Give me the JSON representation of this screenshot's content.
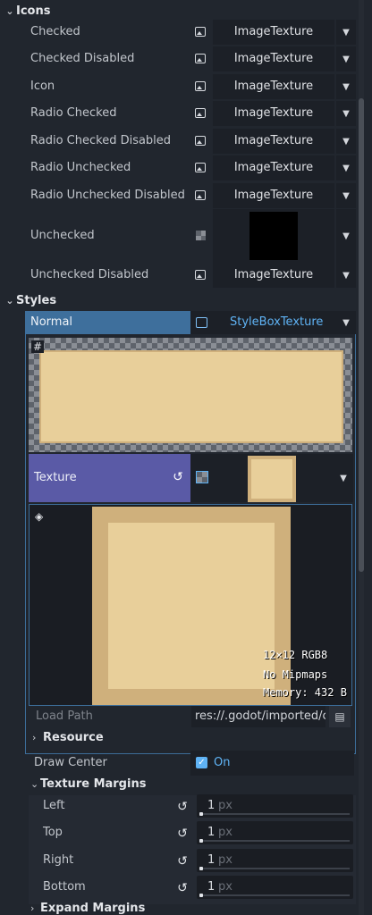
{
  "icons_section": {
    "title": "Icons",
    "rows": [
      {
        "label": "Checked",
        "value": "ImageTexture"
      },
      {
        "label": "Checked Disabled",
        "value": "ImageTexture"
      },
      {
        "label": "Icon",
        "value": "ImageTexture"
      },
      {
        "label": "Radio Checked",
        "value": "ImageTexture"
      },
      {
        "label": "Radio Checked Disabled",
        "value": "ImageTexture"
      },
      {
        "label": "Radio Unchecked",
        "value": "ImageTexture"
      },
      {
        "label": "Radio Unchecked Disabled",
        "value": "ImageTexture"
      }
    ],
    "unchecked_label": "Unchecked",
    "unchecked_disabled": {
      "label": "Unchecked Disabled",
      "value": "ImageTexture"
    }
  },
  "styles_section": {
    "title": "Styles",
    "normal_label": "Normal",
    "normal_value": "StyleBoxTexture",
    "texture_label": "Texture",
    "texture_info": {
      "line1": "12×12 RGB8",
      "line2": "No Mipmaps",
      "line3": "Memory: 432 B"
    },
    "load_path_label": "Load Path",
    "load_path_value": "res://.godot/imported/c",
    "resource_label": "Resource",
    "draw_center_label": "Draw Center",
    "draw_center_value": "On",
    "texture_margins_title": "Texture Margins",
    "margins": [
      {
        "label": "Left",
        "value": "1",
        "unit": "px"
      },
      {
        "label": "Top",
        "value": "1",
        "unit": "px"
      },
      {
        "label": "Right",
        "value": "1",
        "unit": "px"
      },
      {
        "label": "Bottom",
        "value": "1",
        "unit": "px"
      }
    ],
    "expand_margins_title": "Expand Margins"
  },
  "colors": {
    "panel_bg": "#21262e",
    "normal_header": "#3e6f9c",
    "texture_header": "#5a5aa6",
    "accent_blue": "#5fb3f5",
    "texture_tan": "#e8cf9a",
    "texture_border": "#cfb07c"
  }
}
